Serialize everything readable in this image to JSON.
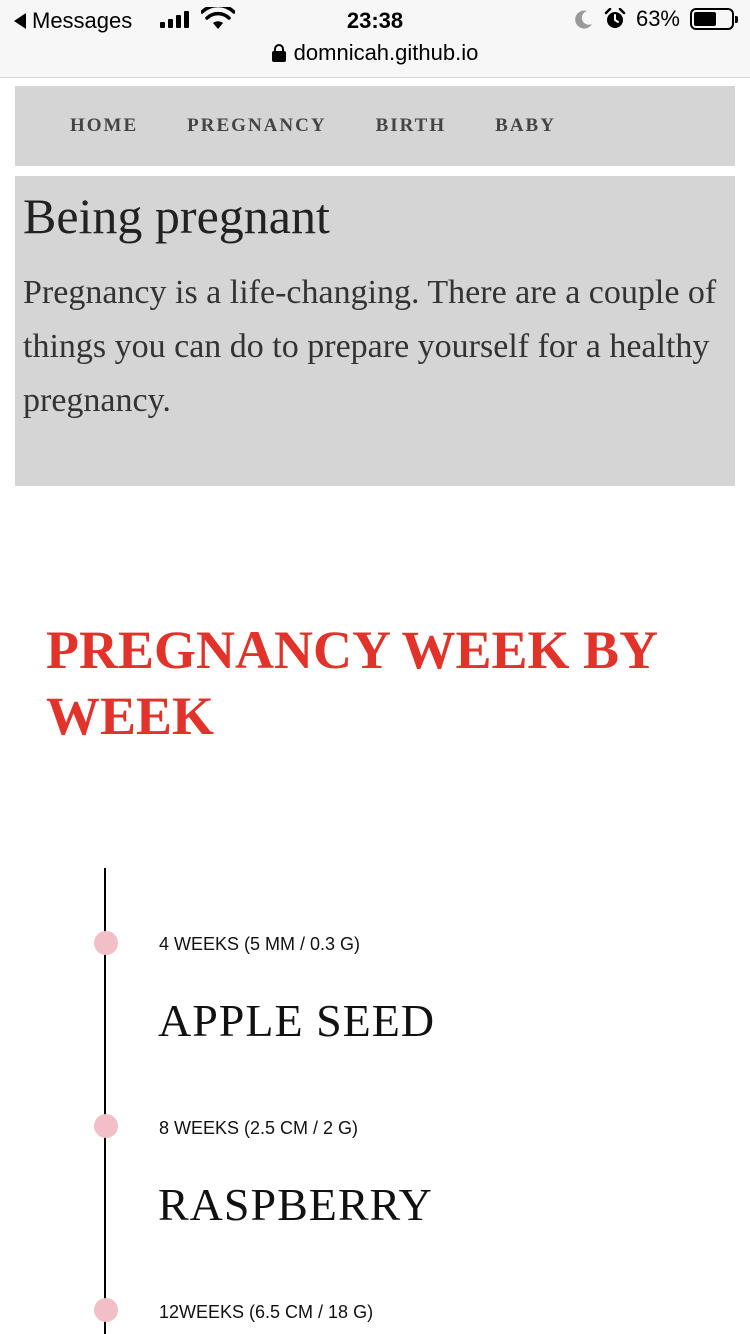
{
  "status_bar": {
    "back_app": "Messages",
    "time": "23:38",
    "battery": "63%",
    "battery_level": 0.63,
    "url": "domnicah.github.io"
  },
  "nav": {
    "items": [
      "HOME",
      "PREGNANCY",
      "BIRTH",
      "BABY"
    ]
  },
  "intro": {
    "title": "Being pregnant",
    "body": "Pregnancy is a life-changing. There are a couple of things you can do to prepare yourself for a healthy pregnancy."
  },
  "section": {
    "title": "PREGNANCY WEEK BY WEEK"
  },
  "timeline": [
    {
      "meta": "4 WEEKS (5 MM / 0.3 G)",
      "name": "APPLE SEED"
    },
    {
      "meta": "8 WEEKS (2.5 CM / 2 G)",
      "name": "RASPBERRY"
    },
    {
      "meta": "12WEEKS (6.5 CM / 18 G)",
      "name": ""
    }
  ],
  "colors": {
    "accent": "#e2332b",
    "panel": "#d5d5d5",
    "dot": "#f2bfc9"
  }
}
